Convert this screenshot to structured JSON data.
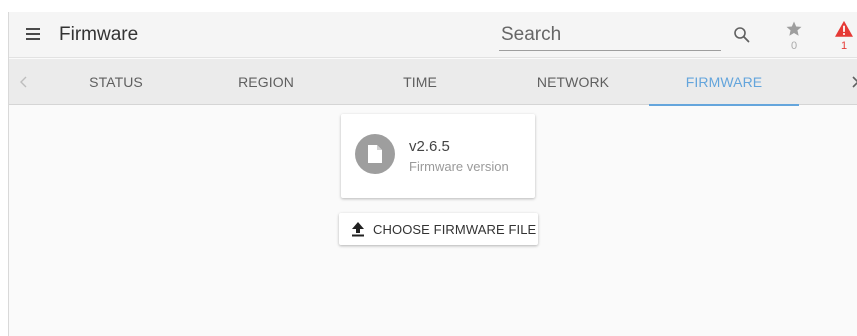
{
  "header": {
    "title": "Firmware",
    "menu_icon": "menu-icon",
    "search_placeholder": "Search",
    "search_value": "",
    "favorites_count": "0",
    "alerts_count": "1"
  },
  "tabs": [
    {
      "label": "STATUS",
      "active": false
    },
    {
      "label": "REGION",
      "active": false
    },
    {
      "label": "TIME",
      "active": false
    },
    {
      "label": "NETWORK",
      "active": false
    },
    {
      "label": "FIRMWARE",
      "active": true
    }
  ],
  "firmware": {
    "version": "v2.6.5",
    "label": "Firmware version",
    "icon": "file-icon"
  },
  "actions": {
    "choose_file_label": "CHOOSE FIRMWARE FILE",
    "choose_file_icon": "upload-icon"
  },
  "colors": {
    "accent": "#64a5dc",
    "alert": "#e53935",
    "appbar": "#f5f5f5",
    "tabbar": "#ebebeb",
    "background": "#fafafa"
  }
}
